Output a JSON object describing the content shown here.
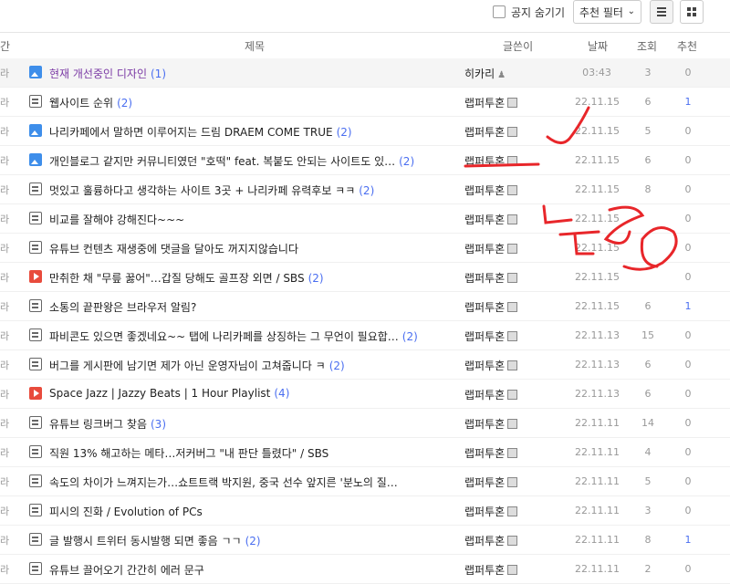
{
  "toolbar": {
    "hide_notice_label": "공지 숨기기",
    "filter_value": "추천 필터",
    "filter_chevron": "⌄"
  },
  "header": {
    "left_cut": "간",
    "title": "제목",
    "author": "글쓴이",
    "date": "날짜",
    "views": "조회",
    "recommend": "추천"
  },
  "rows": [
    {
      "tick": "라",
      "icon": "image",
      "title": "현재 개선중인 디자인",
      "count": "(1)",
      "author": "히카리",
      "author_mark": "user",
      "date": "03:43",
      "views": "3",
      "rec": "0"
    },
    {
      "tick": "라",
      "icon": "doc",
      "title": "웹사이트 순위",
      "count": "(2)",
      "author": "랩퍼투혼",
      "author_mark": "badge",
      "date": "22.11.15",
      "views": "6",
      "rec": "1"
    },
    {
      "tick": "라",
      "icon": "image",
      "title": "나리카페에서 말하면 이루어지는 드림 DRAEM COME TRUE",
      "count": "(2)",
      "author": "랩퍼투혼",
      "author_mark": "badge",
      "date": "22.11.15",
      "views": "5",
      "rec": "0"
    },
    {
      "tick": "라",
      "icon": "image",
      "title": "개인블로그 같지만 커뮤니티였던 \"호떡\" feat. 복붙도 안되는 사이트도 있…",
      "count": "(2)",
      "author": "랩퍼투혼",
      "author_mark": "badge",
      "date": "22.11.15",
      "views": "6",
      "rec": "0"
    },
    {
      "tick": "라",
      "icon": "doc",
      "title": "멋있고 훌륭하다고 생각하는 사이트 3곳 + 나리카페 유력후보 ㅋㅋ",
      "count": "(2)",
      "author": "랩퍼투혼",
      "author_mark": "badge",
      "date": "22.11.15",
      "views": "8",
      "rec": "0"
    },
    {
      "tick": "라",
      "icon": "doc",
      "title": "비교를 잘해야 강해진다~~~",
      "count": "",
      "author": "랩퍼투혼",
      "author_mark": "badge",
      "date": "22.11.15",
      "views": "",
      "rec": "0"
    },
    {
      "tick": "라",
      "icon": "doc",
      "title": "유튜브 컨텐츠 재생중에 댓글을 달아도 꺼지지않습니다",
      "count": "",
      "author": "랩퍼투혼",
      "author_mark": "badge",
      "date": "22.11.15",
      "views": "",
      "rec": "0"
    },
    {
      "tick": "라",
      "icon": "video",
      "title": "만취한 채 \"무릎 꿇어\"…갑질 당해도 골프장 외면 / SBS",
      "count": "(2)",
      "author": "랩퍼투혼",
      "author_mark": "badge",
      "date": "22.11.15",
      "views": "",
      "rec": "0"
    },
    {
      "tick": "라",
      "icon": "doc",
      "title": "소통의 끝판왕은 브라우저 알림?",
      "count": "",
      "author": "랩퍼투혼",
      "author_mark": "badge",
      "date": "22.11.15",
      "views": "6",
      "rec": "1"
    },
    {
      "tick": "라",
      "icon": "doc",
      "title": "파비콘도 있으면 좋겠네요~~ 탭에 나리카페를 상징하는 그 무언이 필요합…",
      "count": "(2)",
      "author": "랩퍼투혼",
      "author_mark": "badge",
      "date": "22.11.13",
      "views": "15",
      "rec": "0"
    },
    {
      "tick": "라",
      "icon": "doc",
      "title": "버그를 게시판에 남기면 제가 아닌 운영자님이 고쳐줍니다 ㅋ",
      "count": "(2)",
      "author": "랩퍼투혼",
      "author_mark": "badge",
      "date": "22.11.13",
      "views": "6",
      "rec": "0"
    },
    {
      "tick": "라",
      "icon": "video",
      "title": "Space Jazz | Jazzy Beats | 1 Hour Playlist",
      "count": "(4)",
      "author": "랩퍼투혼",
      "author_mark": "badge",
      "date": "22.11.13",
      "views": "6",
      "rec": "0"
    },
    {
      "tick": "라",
      "icon": "doc",
      "title": "유튜브 링크버그 찾음",
      "count": "(3)",
      "author": "랩퍼투혼",
      "author_mark": "badge",
      "date": "22.11.11",
      "views": "14",
      "rec": "0"
    },
    {
      "tick": "라",
      "icon": "doc",
      "title": "직원 13% 해고하는 메타…저커버그 \"내 판단 틀렸다\" / SBS",
      "count": "",
      "author": "랩퍼투혼",
      "author_mark": "badge",
      "date": "22.11.11",
      "views": "4",
      "rec": "0"
    },
    {
      "tick": "라",
      "icon": "doc",
      "title": "속도의 차이가 느껴지는가…쇼트트랙 박지원, 중국 선수 앞지른 '분노의 질…",
      "count": "",
      "author": "랩퍼투혼",
      "author_mark": "badge",
      "date": "22.11.11",
      "views": "5",
      "rec": "0"
    },
    {
      "tick": "라",
      "icon": "doc",
      "title": "피시의 진화 / Evolution of PCs",
      "count": "",
      "author": "랩퍼투혼",
      "author_mark": "badge",
      "date": "22.11.11",
      "views": "3",
      "rec": "0"
    },
    {
      "tick": "라",
      "icon": "doc",
      "title": "글 발행시 트위터 동시발행 되면 좋음 ㄱㄱ",
      "count": "(2)",
      "author": "랩퍼투혼",
      "author_mark": "badge",
      "date": "22.11.11",
      "views": "8",
      "rec": "1"
    },
    {
      "tick": "라",
      "icon": "doc",
      "title": "유튜브 끌어오기 간간히 에러 문구",
      "count": "",
      "author": "랩퍼투혼",
      "author_mark": "badge",
      "date": "22.11.11",
      "views": "2",
      "rec": "0"
    }
  ],
  "annotation_color": "#e8262a",
  "accent_color": "#4a6ef0"
}
